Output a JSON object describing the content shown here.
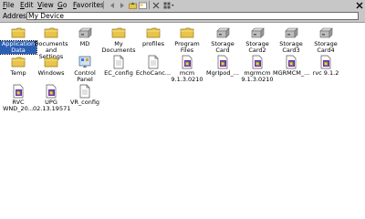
{
  "menu": {
    "file": "File",
    "edit": "Edit",
    "view": "View",
    "go": "Go",
    "favorites": "Favorites"
  },
  "toolbar": {
    "icons": [
      "back-arrow-icon",
      "forward-arrow-icon",
      "up-folder-icon",
      "folders-icon",
      "delete-icon",
      "views-icon"
    ]
  },
  "address": {
    "label": "Address",
    "value": "My Device"
  },
  "items": [
    {
      "label": "Application\nData",
      "icon": "folder-icon",
      "selected": true
    },
    {
      "label": "Documents\nand Settings",
      "icon": "folder-icon"
    },
    {
      "label": "MD",
      "icon": "drive-icon"
    },
    {
      "label": "My\nDocuments",
      "icon": "folder-icon"
    },
    {
      "label": "profiles",
      "icon": "folder-icon"
    },
    {
      "label": "Program Files",
      "icon": "folder-icon"
    },
    {
      "label": "Storage Card",
      "icon": "drive-icon"
    },
    {
      "label": "Storage\nCard2",
      "icon": "drive-icon"
    },
    {
      "label": "Storage\nCard3",
      "icon": "drive-icon"
    },
    {
      "label": "Storage\nCard4",
      "icon": "drive-icon"
    },
    {
      "label": "Temp",
      "icon": "folder-icon"
    },
    {
      "label": "Windows",
      "icon": "folder-icon"
    },
    {
      "label": "Control\nPanel",
      "icon": "control-panel-icon"
    },
    {
      "label": "EC_config",
      "icon": "document-icon"
    },
    {
      "label": "EchoCanc...",
      "icon": "document-icon"
    },
    {
      "label": "mcm\n9.1.3.0210",
      "icon": "installer-icon"
    },
    {
      "label": "MgrIpod_...",
      "icon": "installer-icon"
    },
    {
      "label": "mgrmcm\n9.1.3.0210",
      "icon": "installer-icon"
    },
    {
      "label": "MGRMCM_...",
      "icon": "installer-icon"
    },
    {
      "label": "rvc 9.1.2",
      "icon": "installer-icon"
    },
    {
      "label": "RVC\nWND_20...",
      "icon": "installer-icon"
    },
    {
      "label": "UPG\n02.13.19571",
      "icon": "installer-icon"
    },
    {
      "label": "VR_config",
      "icon": "document-icon"
    }
  ]
}
